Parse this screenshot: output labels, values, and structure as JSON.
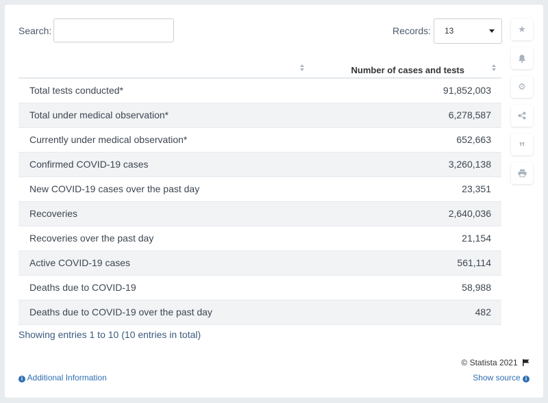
{
  "search": {
    "label": "Search:",
    "value": "",
    "placeholder": ""
  },
  "records": {
    "label": "Records:",
    "selected": "13"
  },
  "table": {
    "columns": [
      "",
      "Number of cases and tests"
    ],
    "rows": [
      {
        "label": "Total tests conducted*",
        "value": "91,852,003"
      },
      {
        "label": "Total under medical observation*",
        "value": "6,278,587"
      },
      {
        "label": "Currently under medical observation*",
        "value": "652,663"
      },
      {
        "label": "Confirmed COVID-19 cases",
        "value": "3,260,138"
      },
      {
        "label": "New COVID-19 cases over the past day",
        "value": "23,351"
      },
      {
        "label": "Recoveries",
        "value": "2,640,036"
      },
      {
        "label": "Recoveries over the past day",
        "value": "21,154"
      },
      {
        "label": "Active COVID-19 cases",
        "value": "561,114"
      },
      {
        "label": "Deaths due to COVID-19",
        "value": "58,988"
      },
      {
        "label": "Deaths due to COVID-19 over the past day",
        "value": "482"
      }
    ]
  },
  "footer": {
    "entries": "Showing entries 1 to 10 (10 entries in total)",
    "copyright": "© Statista 2021",
    "additional_info": "Additional Information",
    "show_source": "Show source"
  },
  "sidebar_icons": [
    "star-icon",
    "bell-icon",
    "gear-icon",
    "share-icon",
    "quote-icon",
    "print-icon"
  ],
  "colors": {
    "link": "#2f6fb0",
    "row_alt": "#f1f3f5",
    "background": "#e9ecef"
  }
}
